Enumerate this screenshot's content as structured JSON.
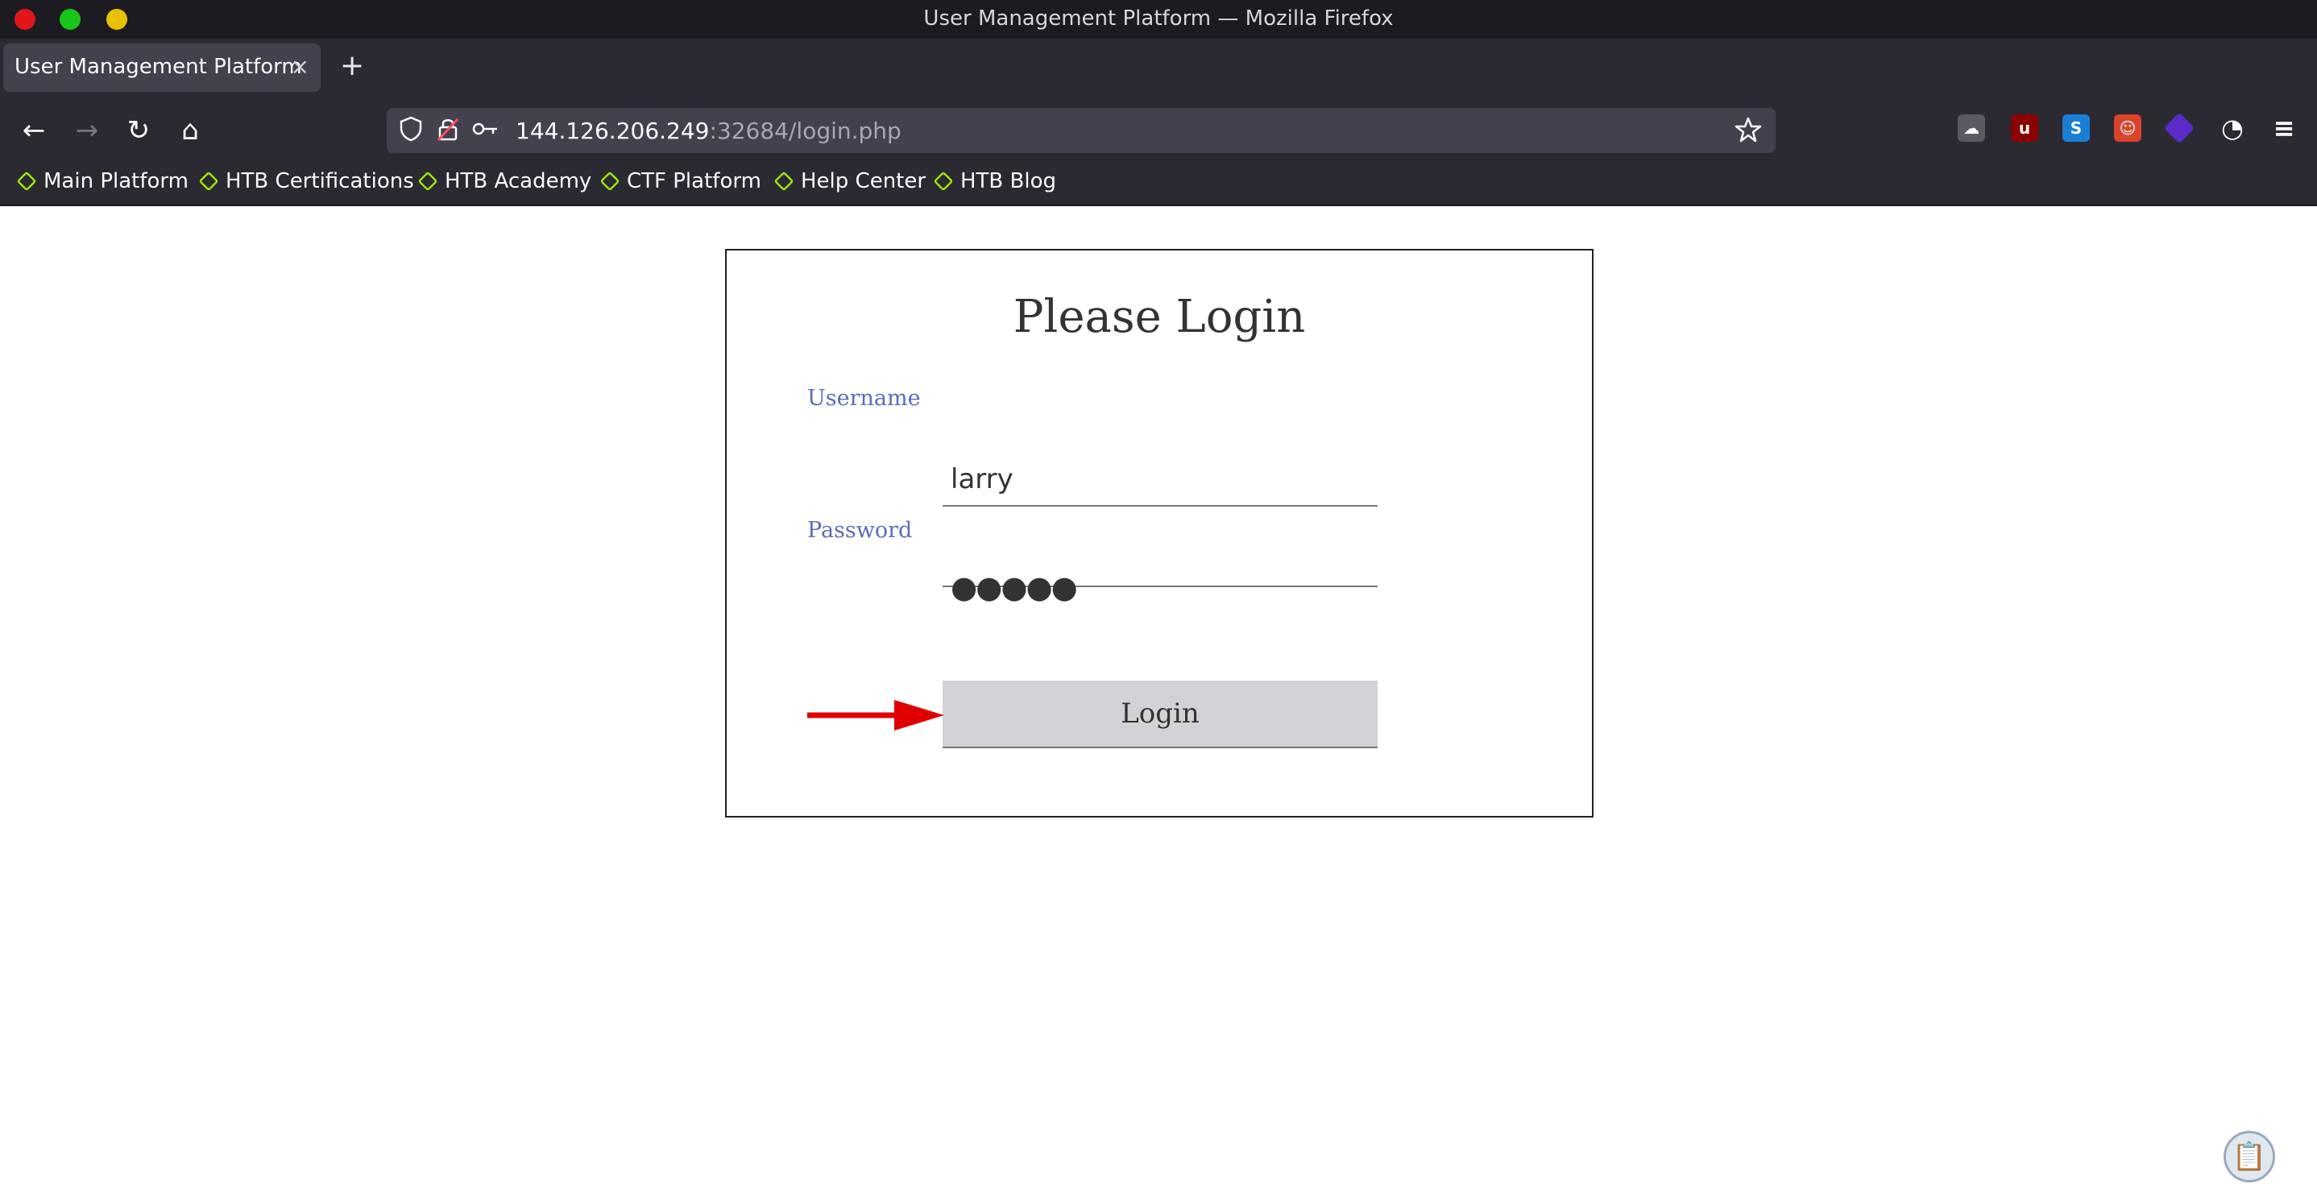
{
  "window": {
    "title": "User Management Platform — Mozilla Firefox"
  },
  "tabs": [
    {
      "label": "User Management Platform",
      "close": "×"
    }
  ],
  "newtab_label": "+",
  "nav": {
    "back": "←",
    "forward": "→",
    "reload": "↻",
    "home": "⌂"
  },
  "urlbar": {
    "host": "144.126.206.249",
    "path": ":32684/login.php",
    "icons": [
      "shield-icon",
      "lock-warning-icon",
      "key-icon",
      "bookmark-star-icon"
    ]
  },
  "extensions": [
    "cloud-icon",
    "ublock-icon",
    "s-extension-icon",
    "devil-icon",
    "layers-icon",
    "cookie-icon",
    "menu-icon"
  ],
  "bookmarks": [
    {
      "label": "Main Platform"
    },
    {
      "label": "HTB Certifications"
    },
    {
      "label": "HTB Academy"
    },
    {
      "label": "CTF Platform"
    },
    {
      "label": "Help Center"
    },
    {
      "label": "HTB Blog"
    }
  ],
  "login": {
    "title": "Please Login",
    "username_label": "Username",
    "username_value": "larry",
    "password_label": "Password",
    "password_mask": "●●●●●",
    "button_label": "Login"
  },
  "colors": {
    "label": "#5b6bbf",
    "button_bg": "#d1d1d6",
    "arrow": "#e00000",
    "bookmark_icon": "#9fef00"
  }
}
